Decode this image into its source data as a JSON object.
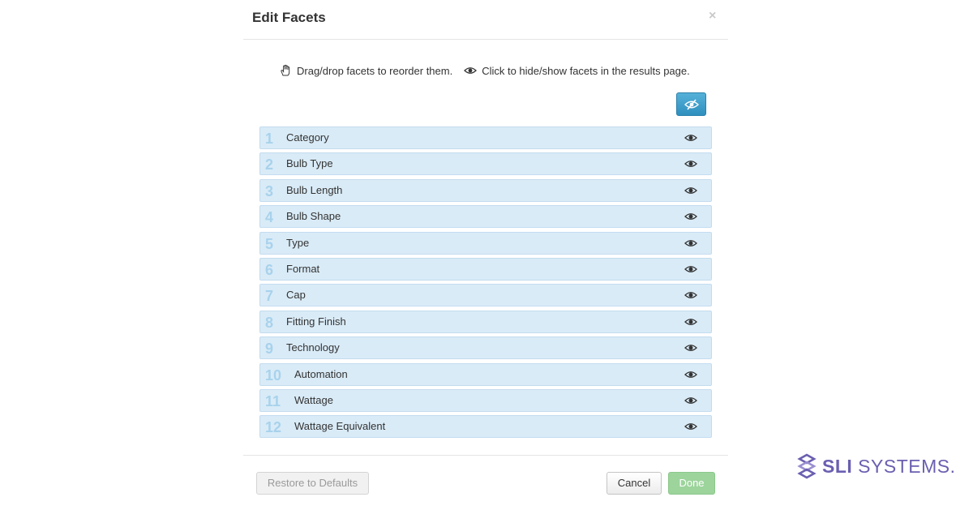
{
  "dialog": {
    "title": "Edit Facets",
    "close_label": "×"
  },
  "instructions": {
    "drag_icon": "hand-icon",
    "drag_text": "Drag/drop facets to reorder them.",
    "eye_icon": "eye-icon",
    "eye_text": "Click to hide/show facets in the results page."
  },
  "toggle_all": {
    "icon": "eye-slash-icon"
  },
  "facets": [
    {
      "number": "1",
      "label": "Category"
    },
    {
      "number": "2",
      "label": "Bulb Type"
    },
    {
      "number": "3",
      "label": "Bulb Length"
    },
    {
      "number": "4",
      "label": "Bulb Shape"
    },
    {
      "number": "5",
      "label": "Type"
    },
    {
      "number": "6",
      "label": "Format"
    },
    {
      "number": "7",
      "label": "Cap"
    },
    {
      "number": "8",
      "label": "Fitting Finish"
    },
    {
      "number": "9",
      "label": "Technology"
    },
    {
      "number": "10",
      "label": "Automation"
    },
    {
      "number": "11",
      "label": "Wattage"
    },
    {
      "number": "12",
      "label": "Wattage Equivalent"
    }
  ],
  "footer": {
    "restore_label": "Restore to Defaults",
    "cancel_label": "Cancel",
    "done_label": "Done"
  },
  "logo": {
    "text_bold": "SLI",
    "text_rest": "SYSTEMS."
  },
  "colors": {
    "row_bg": "#d9ebf7",
    "row_number": "#a8d2ec",
    "toggle_button": "#3a9ccb",
    "done_button": "#9cd49b",
    "logo": "#6a5fb0"
  }
}
